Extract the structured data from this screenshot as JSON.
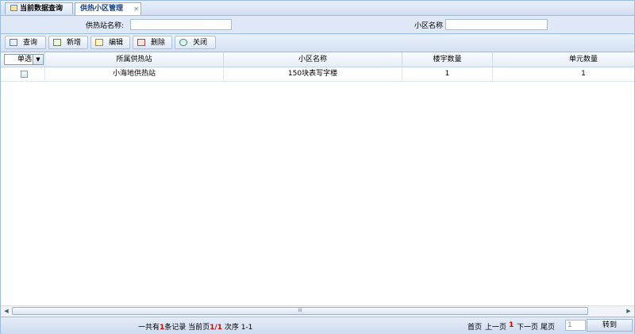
{
  "tabs": [
    {
      "label": "当前数据查询",
      "active": false
    },
    {
      "label": "供热小区管理",
      "active": true
    }
  ],
  "search": {
    "station_label": "供热站名称:",
    "station_value": "",
    "district_label": "小区名称",
    "district_value": ""
  },
  "toolbar": {
    "query": "查询",
    "add": "新增",
    "edit": "编辑",
    "delete": "删除",
    "close": "关闭"
  },
  "grid": {
    "select_mode": "单选",
    "columns": [
      "所属供热站",
      "小区名称",
      "楼宇数量",
      "单元数量"
    ],
    "rows": [
      {
        "station": "小海地供热站",
        "district": "150块表写字楼",
        "buildings": "1",
        "units": "1"
      }
    ]
  },
  "scrollbar": {
    "grip": "III"
  },
  "pager": {
    "t1": "一共有",
    "count": "1",
    "t2": "条记录  当前页",
    "page": "1/1",
    "t3": " 次序 1-1",
    "first": "首页",
    "prev": "上一页",
    "current": "1",
    "next": "下一页",
    "last": "尾页",
    "goto_value": "1",
    "goto_label": "转到"
  },
  "colors": {
    "border": "#99bbe8",
    "tab_text": "#15428b",
    "highlight": "#dd0000"
  }
}
